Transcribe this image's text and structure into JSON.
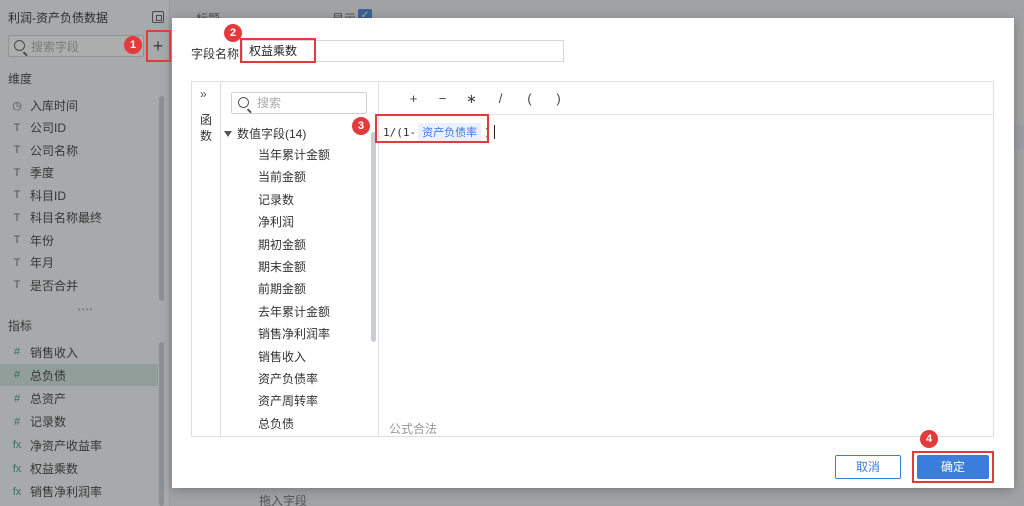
{
  "left_panel": {
    "title": "利润-资产负债数据",
    "search_placeholder": "搜索字段",
    "add_label": "+",
    "dimension_label": "维度",
    "dimensions": [
      {
        "icon": "clock",
        "glyph": "◷",
        "label": "入库时间"
      },
      {
        "icon": "text",
        "glyph": "T",
        "label": "公司ID"
      },
      {
        "icon": "text",
        "glyph": "T",
        "label": "公司名称"
      },
      {
        "icon": "text",
        "glyph": "T",
        "label": "季度"
      },
      {
        "icon": "text",
        "glyph": "T",
        "label": "科目ID"
      },
      {
        "icon": "text",
        "glyph": "T",
        "label": "科目名称最终"
      },
      {
        "icon": "text",
        "glyph": "T",
        "label": "年份"
      },
      {
        "icon": "text",
        "glyph": "T",
        "label": "年月"
      },
      {
        "icon": "text",
        "glyph": "T",
        "label": "是否合并"
      }
    ],
    "metric_label": "指标",
    "metrics": [
      {
        "icon": "number",
        "glyph": "#",
        "label": "销售收入",
        "selected": false
      },
      {
        "icon": "number",
        "glyph": "#",
        "label": "总负债",
        "selected": true
      },
      {
        "icon": "number",
        "glyph": "#",
        "label": "总资产",
        "selected": false
      },
      {
        "icon": "number",
        "glyph": "#",
        "label": "记录数",
        "selected": false
      },
      {
        "icon": "formula",
        "glyph": "fx",
        "label": "净资产收益率",
        "selected": false
      },
      {
        "icon": "formula",
        "glyph": "fx",
        "label": "权益乘数",
        "selected": false
      },
      {
        "icon": "formula",
        "glyph": "fx",
        "label": "销售净利润率",
        "selected": false
      }
    ]
  },
  "background": {
    "title_label": "标题",
    "show_label": "显示",
    "drop_label": "拖入字段"
  },
  "modal": {
    "field_name_label": "字段名称",
    "field_name_value": "权益乘数",
    "fn_tab_label": "函数",
    "fields_search_placeholder": "搜索",
    "group_label": "数值字段(14)",
    "fields": [
      "当年累计金额",
      "当前金额",
      "记录数",
      "净利润",
      "期初金额",
      "期末金额",
      "前期金额",
      "去年累计金额",
      "销售净利润率",
      "销售收入",
      "资产负债率",
      "资产周转率",
      "总负债"
    ],
    "operators": [
      "+",
      "−",
      "∗",
      "/",
      "(",
      ")"
    ],
    "formula_prefix": "1/(1-",
    "formula_field": "资产负债率",
    "formula_suffix": ")",
    "formula_status": "公式合法",
    "cancel_label": "取消",
    "ok_label": "确定"
  },
  "annotations": {
    "badges": [
      "1",
      "2",
      "3",
      "4"
    ],
    "color": "#e23b3b"
  },
  "colors": {
    "accent": "#3b7ddd",
    "metric_green": "#2e9e77",
    "selected_row": "#cfe6df"
  }
}
